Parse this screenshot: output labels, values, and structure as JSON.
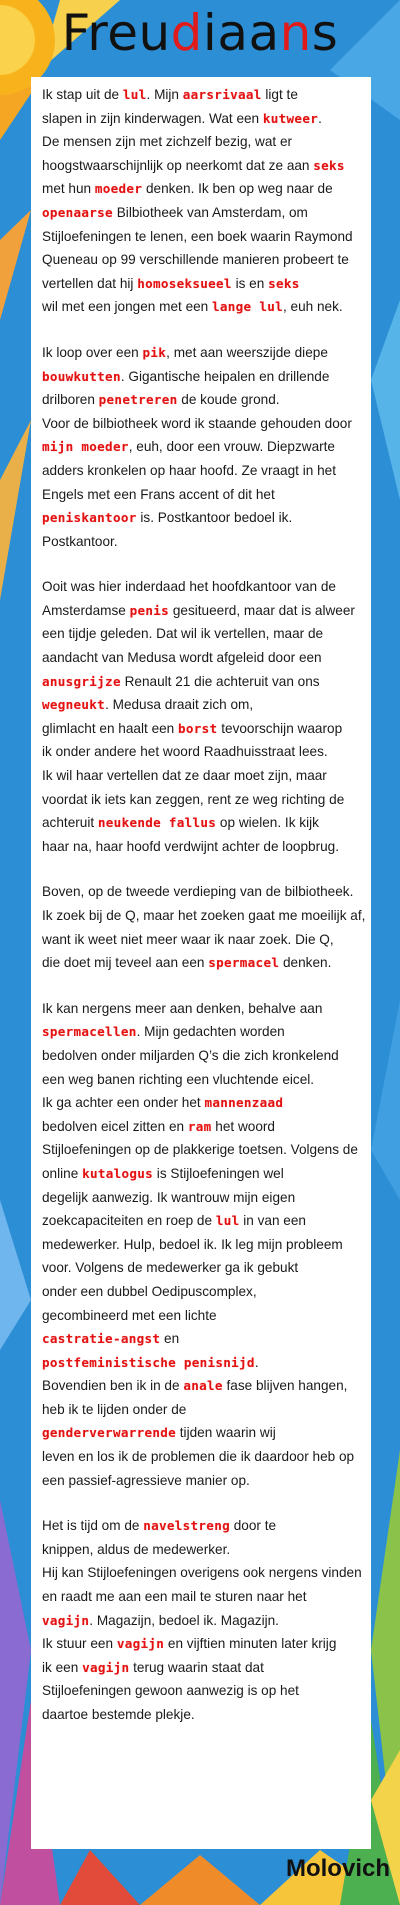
{
  "title": {
    "before": "Freu",
    "highlight": "d",
    "middle": "iaa",
    "highlight2": "n",
    "after": "s"
  },
  "signature": "Molovich",
  "paragraphs": [
    [
      [
        {
          "t": "Ik stap uit de "
        },
        {
          "w": "lul"
        },
        {
          "t": ". Mijn "
        },
        {
          "w": "aarsrivaal"
        },
        {
          "t": " ligt te"
        }
      ],
      [
        {
          "t": "slapen in zijn kinderwagen. Wat een "
        },
        {
          "w": "kutweer"
        },
        {
          "t": "."
        }
      ],
      [
        {
          "t": "De mensen zijn met zichzelf bezig, wat er"
        }
      ],
      [
        {
          "t": "hoogstwaarschijnlijk op neerkomt dat ze aan "
        },
        {
          "w": "seks"
        }
      ],
      [
        {
          "t": "met hun "
        },
        {
          "w": "moeder"
        },
        {
          "t": " denken. Ik ben op weg naar de"
        }
      ],
      [
        {
          "w": "openaarse"
        },
        {
          "t": " Bilbiotheek van Amsterdam, om"
        }
      ],
      [
        {
          "t": "Stijloefeningen te lenen, een boek waarin Raymond"
        }
      ],
      [
        {
          "t": "Queneau op 99 verschillende manieren probeert te"
        }
      ],
      [
        {
          "t": "vertellen dat hij "
        },
        {
          "w": "homoseksueel"
        },
        {
          "t": " is en "
        },
        {
          "w": "seks"
        }
      ],
      [
        {
          "t": "wil met een jongen met een "
        },
        {
          "w": "lange lul"
        },
        {
          "t": ", euh nek."
        }
      ]
    ],
    [
      [
        {
          "t": "Ik loop over een "
        },
        {
          "w": "pik"
        },
        {
          "t": ", met aan weerszijde diepe"
        }
      ],
      [
        {
          "w": "bouwkutten"
        },
        {
          "t": ". Gigantische heipalen en drillende"
        }
      ],
      [
        {
          "t": "drilboren "
        },
        {
          "w": "penetreren"
        },
        {
          "t": " de koude grond."
        }
      ],
      [
        {
          "t": "Voor de bilbiotheek word ik staande gehouden door"
        }
      ],
      [
        {
          "w": "mijn moeder"
        },
        {
          "t": ", euh, door een vrouw. Diepzwarte"
        }
      ],
      [
        {
          "t": "adders kronkelen op haar hoofd. Ze vraagt in het"
        }
      ],
      [
        {
          "t": "Engels met een Frans accent of dit het"
        }
      ],
      [
        {
          "w": "peniskantoor"
        },
        {
          "t": " is. Postkantoor bedoel ik."
        }
      ],
      [
        {
          "t": "Postkantoor."
        }
      ]
    ],
    [
      [
        {
          "t": "Ooit was hier inderdaad het hoofdkantoor van de"
        }
      ],
      [
        {
          "t": "Amsterdamse "
        },
        {
          "w": "penis"
        },
        {
          "t": " gesitueerd, maar dat is alweer"
        }
      ],
      [
        {
          "t": "een tijdje geleden. Dat wil ik vertellen, maar de"
        }
      ],
      [
        {
          "t": "aandacht van Medusa wordt afgeleid door een"
        }
      ],
      [
        {
          "w": "anusgrijze"
        },
        {
          "t": " Renault 21 die achteruit van ons"
        }
      ],
      [
        {
          "w": "wegneukt"
        },
        {
          "t": ".  Medusa draait zich om,"
        }
      ],
      [
        {
          "t": "glimlacht en haalt een "
        },
        {
          "w": "borst"
        },
        {
          "t": " tevoorschijn waarop"
        }
      ],
      [
        {
          "t": "ik onder andere het woord Raadhuisstraat lees."
        }
      ],
      [
        {
          "t": "Ik wil haar vertellen dat ze daar moet zijn, maar"
        }
      ],
      [
        {
          "t": "voordat ik iets kan zeggen, rent ze weg richting de"
        }
      ],
      [
        {
          "t": "achteruit "
        },
        {
          "w": "neukende fallus"
        },
        {
          "t": " op wielen. Ik kijk"
        }
      ],
      [
        {
          "t": "haar na, haar hoofd verdwijnt achter de loopbrug."
        }
      ]
    ],
    [
      [
        {
          "t": "Boven, op de tweede verdieping van de bilbiotheek."
        }
      ],
      [
        {
          "t": "Ik zoek bij de Q, maar het zoeken gaat me moeilijk af,"
        }
      ],
      [
        {
          "t": "want ik weet niet meer waar ik naar zoek. Die Q,"
        }
      ],
      [
        {
          "t": "die doet mij teveel aan een "
        },
        {
          "w": "spermacel"
        },
        {
          "t": " denken."
        }
      ]
    ],
    [
      [
        {
          "t": "Ik kan nergens meer aan denken, behalve aan"
        }
      ],
      [
        {
          "w": "spermacellen"
        },
        {
          "t": ". Mijn gedachten worden"
        }
      ],
      [
        {
          "t": "bedolven onder miljarden Q’s die zich kronkelend"
        }
      ],
      [
        {
          "t": "een weg banen richting een vluchtende eicel."
        }
      ],
      [
        {
          "t": "Ik ga achter een onder het "
        },
        {
          "w": "mannenzaad"
        }
      ],
      [
        {
          "t": "bedolven eicel zitten en "
        },
        {
          "w": "ram"
        },
        {
          "t": " het woord"
        }
      ],
      [
        {
          "t": "Stijloefeningen op de plakkerige toetsen. Volgens de"
        }
      ],
      [
        {
          "t": "online "
        },
        {
          "w": "kutalogus"
        },
        {
          "t": " is Stijloefeningen wel"
        }
      ],
      [
        {
          "t": "degelijk aanwezig. Ik wantrouw mijn eigen"
        }
      ],
      [
        {
          "t": "zoekcapaciteiten en roep de "
        },
        {
          "w": "lul"
        },
        {
          "t": " in van een"
        }
      ],
      [
        {
          "t": "medewerker. Hulp, bedoel ik. Ik  leg mijn probleem"
        }
      ],
      [
        {
          "t": "voor. Volgens de medewerker ga ik gebukt"
        }
      ],
      [
        {
          "t": "onder een dubbel Oedipuscomplex,"
        }
      ],
      [
        {
          "t": "gecombineerd met een lichte"
        }
      ],
      [
        {
          "w": "castratie-angst"
        },
        {
          "t": " en"
        }
      ],
      [
        {
          "w": "postfeministische penisnijd"
        },
        {
          "t": "."
        }
      ],
      [
        {
          "t": "Bovendien ben ik in de "
        },
        {
          "w": "anale"
        },
        {
          "t": " fase blijven hangen,"
        }
      ],
      [
        {
          "t": "heb ik te lijden onder de"
        }
      ],
      [
        {
          "w": "genderverwarrende"
        },
        {
          "t": " tijden waarin wij"
        }
      ],
      [
        {
          "t": "leven en los ik de problemen die ik daardoor heb op"
        }
      ],
      [
        {
          "t": "een passief-agressieve manier op."
        }
      ]
    ],
    [
      [
        {
          "t": "Het is tijd om de "
        },
        {
          "w": "navelstreng"
        },
        {
          "t": " door te"
        }
      ],
      [
        {
          "t": "knippen, aldus de medewerker."
        }
      ],
      [
        {
          "t": "Hij kan Stijloefeningen overigens ook nergens vinden"
        }
      ],
      [
        {
          "t": "en raadt me aan een mail te sturen naar het"
        }
      ],
      [
        {
          "w": "vagijn"
        },
        {
          "t": ". Magazijn, bedoel ik. Magazijn."
        }
      ],
      [
        {
          "t": "Ik stuur een "
        },
        {
          "w": "vagijn"
        },
        {
          "t": " en vijftien minuten later krijg"
        }
      ],
      [
        {
          "t": "ik een "
        },
        {
          "w": "vagijn"
        },
        {
          "t": " terug waarin staat dat"
        }
      ],
      [
        {
          "t": "Stijloefeningen gewoon aanwezig is op het"
        }
      ],
      [
        {
          "t": "daartoe bestemde plekje."
        }
      ]
    ]
  ],
  "colors": {
    "accent": "#e31212",
    "sun": "#f6a21a",
    "sky": "#2a8fd6"
  }
}
